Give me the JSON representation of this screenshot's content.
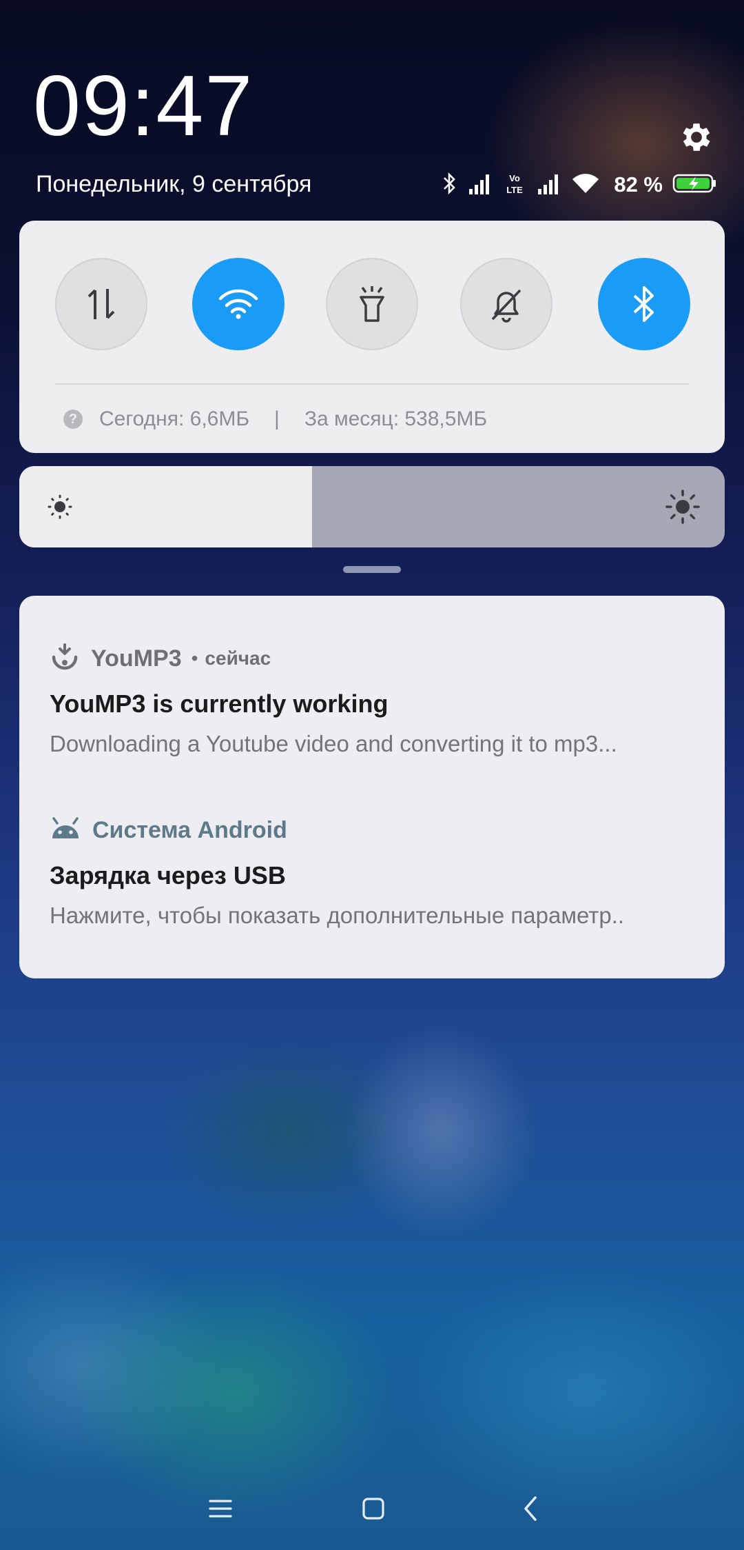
{
  "header": {
    "time": "09:47",
    "date": "Понедельник, 9 сентября",
    "battery_percent": "82 %",
    "icons": [
      "bluetooth-icon",
      "signal-icon",
      "volte-icon",
      "signal-icon",
      "wifi-icon",
      "battery-charging-icon",
      "gear-icon"
    ]
  },
  "quick_settings": {
    "toggles": [
      {
        "name": "mobile-data",
        "icon": "data-arrows-icon",
        "on": false
      },
      {
        "name": "wifi",
        "icon": "wifi-icon",
        "on": true
      },
      {
        "name": "flashlight",
        "icon": "flashlight-icon",
        "on": false
      },
      {
        "name": "silent",
        "icon": "bell-off-icon",
        "on": false
      },
      {
        "name": "bluetooth",
        "icon": "bluetooth-icon",
        "on": true
      }
    ],
    "usage_today": "Сегодня: 6,6МБ",
    "usage_separator": "|",
    "usage_month": "За месяц: 538,5МБ",
    "help_glyph": "?"
  },
  "brightness": {
    "level": 0.415
  },
  "notifications": [
    {
      "app": "YouMP3",
      "dot": "•",
      "time": "сейчас",
      "title": "YouMP3 is currently working",
      "text": "Downloading a Youtube video and converting it to mp3..."
    },
    {
      "app": "Система Android",
      "title": "Зарядка через USB",
      "text": "Нажмите, чтобы показать дополнительные параметр.."
    }
  ],
  "nav": {
    "icons": [
      "menu-icon",
      "home-icon",
      "back-icon"
    ]
  },
  "colors": {
    "accent": "#1a9bf6",
    "panel": "#eeeef1",
    "android_app": "#5d7a8a"
  }
}
